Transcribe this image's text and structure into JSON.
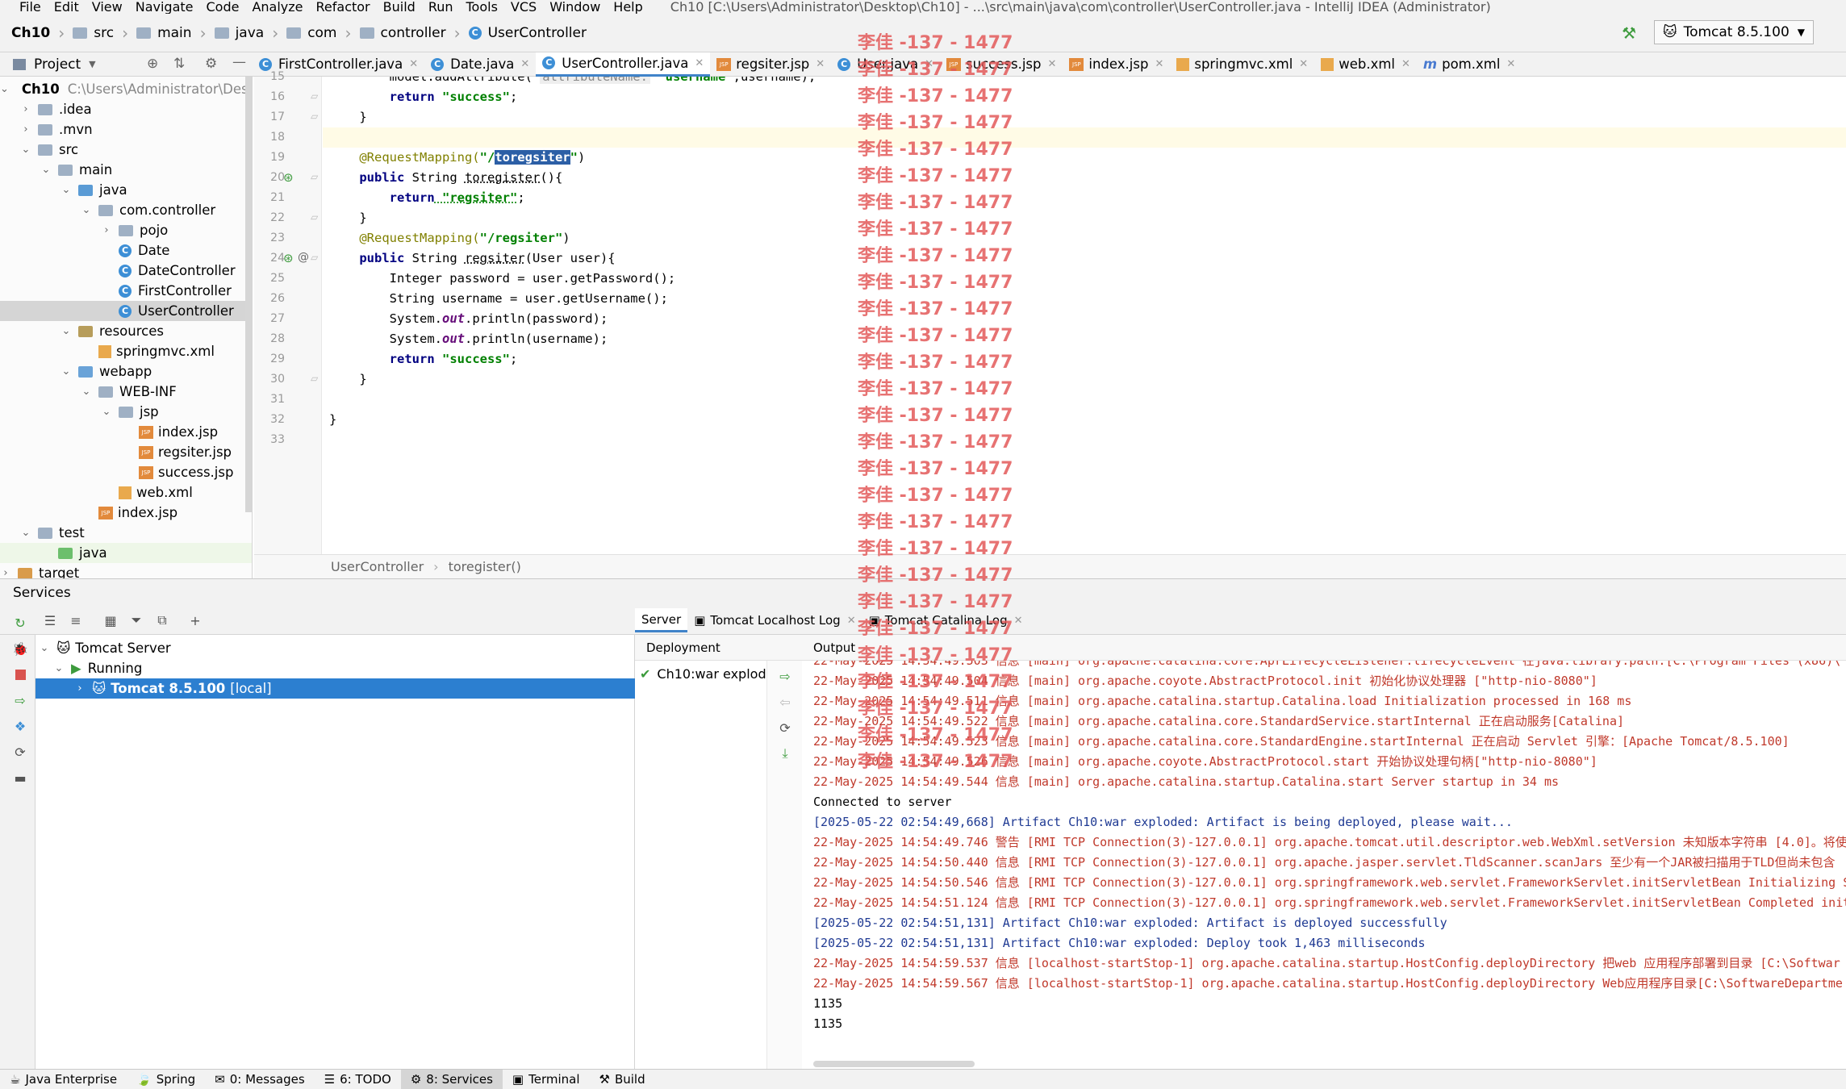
{
  "menu": {
    "items": [
      "File",
      "Edit",
      "View",
      "Navigate",
      "Code",
      "Analyze",
      "Refactor",
      "Build",
      "Run",
      "Tools",
      "VCS",
      "Window",
      "Help"
    ],
    "window_title": "Ch10 [C:\\Users\\Administrator\\Desktop\\Ch10] - ...\\src\\main\\java\\com\\controller\\UserController.java - IntelliJ IDEA (Administrator)"
  },
  "breadcrumbs": [
    "Ch10",
    "src",
    "main",
    "java",
    "com",
    "controller",
    "UserController"
  ],
  "run_config": "Tomcat 8.5.100",
  "project_panel": {
    "title": "Project",
    "root_path": "C:\\Users\\Administrator\\Deskto",
    "nodes": [
      {
        "label": "Ch10",
        "depth": 0,
        "arrow": "down",
        "icon": "folder"
      },
      {
        "label": ".idea",
        "depth": 1,
        "arrow": "right",
        "icon": "folder"
      },
      {
        "label": ".mvn",
        "depth": 1,
        "arrow": "right",
        "icon": "folder"
      },
      {
        "label": "src",
        "depth": 1,
        "arrow": "down",
        "icon": "folder"
      },
      {
        "label": "main",
        "depth": 2,
        "arrow": "down",
        "icon": "folder"
      },
      {
        "label": "java",
        "depth": 3,
        "arrow": "down",
        "icon": "folder-blue"
      },
      {
        "label": "com.controller",
        "depth": 4,
        "arrow": "down",
        "icon": "package"
      },
      {
        "label": "pojo",
        "depth": 5,
        "arrow": "right",
        "icon": "package"
      },
      {
        "label": "Date",
        "depth": 5,
        "arrow": "",
        "icon": "class"
      },
      {
        "label": "DateController",
        "depth": 5,
        "arrow": "",
        "icon": "class"
      },
      {
        "label": "FirstController",
        "depth": 5,
        "arrow": "",
        "icon": "class"
      },
      {
        "label": "UserController",
        "depth": 5,
        "arrow": "",
        "icon": "class"
      },
      {
        "label": "resources",
        "depth": 3,
        "arrow": "down",
        "icon": "folder-res"
      },
      {
        "label": "springmvc.xml",
        "depth": 4,
        "arrow": "",
        "icon": "xml"
      },
      {
        "label": "webapp",
        "depth": 3,
        "arrow": "down",
        "icon": "folder-web"
      },
      {
        "label": "WEB-INF",
        "depth": 4,
        "arrow": "down",
        "icon": "folder"
      },
      {
        "label": "jsp",
        "depth": 5,
        "arrow": "down",
        "icon": "folder"
      },
      {
        "label": "index.jsp",
        "depth": 6,
        "arrow": "",
        "icon": "jsp"
      },
      {
        "label": "regsiter.jsp",
        "depth": 6,
        "arrow": "",
        "icon": "jsp"
      },
      {
        "label": "success.jsp",
        "depth": 6,
        "arrow": "",
        "icon": "jsp"
      },
      {
        "label": "web.xml",
        "depth": 5,
        "arrow": "",
        "icon": "xml"
      },
      {
        "label": "index.jsp",
        "depth": 4,
        "arrow": "",
        "icon": "jsp"
      },
      {
        "label": "test",
        "depth": 1,
        "arrow": "down",
        "icon": "folder"
      },
      {
        "label": "java",
        "depth": 2,
        "arrow": "",
        "icon": "folder-green"
      },
      {
        "label": "target",
        "depth": 0,
        "arrow": "right",
        "icon": "folder-orange"
      }
    ]
  },
  "editor_tabs": [
    "FirstController.java",
    "Date.java",
    "UserController.java",
    "regsiter.jsp",
    "User.java",
    "success.jsp",
    "index.jsp",
    "springmvc.xml",
    "web.xml",
    "pom.xml"
  ],
  "code": {
    "line_numbers": [
      "15",
      "16",
      "17",
      "18",
      "19",
      "20",
      "21",
      "22",
      "23",
      "24",
      "25",
      "26",
      "27",
      "28",
      "29",
      "30",
      "31",
      "32",
      "33"
    ],
    "l15_a": "        model.addAttribute( ",
    "l15_hint": "attributeName:",
    "l15_str": " \"username\"",
    "l15_b": ",username);",
    "l16_kw": "        return",
    "l16_str": " \"success\"",
    "l16_b": ";",
    "l17": "    }",
    "l19_ann": "    @RequestMapping(",
    "l19_str_a": "\"/",
    "l19_sel": "toregsiter",
    "l19_str_b": "\"",
    "l19_end": ")",
    "l20_kw": "    public",
    "l20_b": " String ",
    "l20_name": "toregister",
    "l20_c": "(){",
    "l21_kw": "        return",
    "l21_str": " \"regsiter\"",
    "l21_b": ";",
    "l22": "    }",
    "l23_ann": "    @RequestMapping(",
    "l23_str": "\"/regsiter\"",
    "l23_end": ")",
    "l24_kw": "    public",
    "l24_b": " String ",
    "l24_name": "regsiter",
    "l24_c": "(User user){",
    "l25": "        Integer password = user.getPassword();",
    "l26": "        String username = user.getUsername();",
    "l27_a": "        System.",
    "l27_fld": "out",
    "l27_b": ".println(password);",
    "l28_a": "        System.",
    "l28_fld": "out",
    "l28_b": ".println(username);",
    "l29_kw": "        return",
    "l29_str": " \"success\"",
    "l29_b": ";",
    "l30": "    }",
    "l32": "}"
  },
  "editor_breadcrumb": [
    "UserController",
    "toregister()"
  ],
  "services": {
    "title": "Services",
    "tree": {
      "server": "Tomcat Server",
      "status": "Running",
      "instance": "Tomcat 8.5.100",
      "instance_suffix": "[local]"
    },
    "tabs": [
      "Server",
      "Tomcat Localhost Log",
      "Tomcat Catalina Log"
    ],
    "deployment_header": "Deployment",
    "deployment_item": "Ch10:war exploded",
    "output_header": "Output",
    "output_lines": [
      {
        "cls": "red",
        "text": "22-May-2025 14:54:49.503 信息 [main] org.apache.catalina.core.AprLifecycleListener.lifecycleEvent 在java.library.path:[C:\\Program Files (x86)\\"
      },
      {
        "cls": "red",
        "text": "22-May-2025 14:54:49.504 信息 [main] org.apache.coyote.AbstractProtocol.init 初始化协议处理器 [\"http-nio-8080\"]"
      },
      {
        "cls": "red",
        "text": "22-May-2025 14:54:49.511 信息 [main] org.apache.catalina.startup.Catalina.load Initialization processed in 168 ms"
      },
      {
        "cls": "red",
        "text": "22-May-2025 14:54:49.522 信息 [main] org.apache.catalina.core.StandardService.startInternal 正在启动服务[Catalina]"
      },
      {
        "cls": "red",
        "text": "22-May-2025 14:54:49.523 信息 [main] org.apache.catalina.core.StandardEngine.startInternal 正在启动 Servlet 引擎：[Apache Tomcat/8.5.100]"
      },
      {
        "cls": "red",
        "text": "22-May-2025 14:54:49.526 信息 [main] org.apache.coyote.AbstractProtocol.start 开始协议处理句柄[\"http-nio-8080\"]"
      },
      {
        "cls": "red",
        "text": "22-May-2025 14:54:49.544 信息 [main] org.apache.catalina.startup.Catalina.start Server startup in 34 ms"
      },
      {
        "cls": "blk",
        "text": "Connected to server"
      },
      {
        "cls": "blue",
        "text": "[2025-05-22 02:54:49,668] Artifact Ch10:war exploded: Artifact is being deployed, please wait..."
      },
      {
        "cls": "red",
        "text": "22-May-2025 14:54:49.746 警告 [RMI TCP Connection(3)-127.0.0.1] org.apache.tomcat.util.descriptor.web.WebXml.setVersion 未知版本字符串 [4.0]。将使"
      },
      {
        "cls": "red",
        "text": "22-May-2025 14:54:50.440 信息 [RMI TCP Connection(3)-127.0.0.1] org.apache.jasper.servlet.TldScanner.scanJars 至少有一个JAR被扫描用于TLD但尚未包含"
      },
      {
        "cls": "red",
        "text": "22-May-2025 14:54:50.546 信息 [RMI TCP Connection(3)-127.0.0.1] org.springframework.web.servlet.FrameworkServlet.initServletBean Initializing S"
      },
      {
        "cls": "red",
        "text": "22-May-2025 14:54:51.124 信息 [RMI TCP Connection(3)-127.0.0.1] org.springframework.web.servlet.FrameworkServlet.initServletBean Completed init"
      },
      {
        "cls": "blue",
        "text": "[2025-05-22 02:54:51,131] Artifact Ch10:war exploded: Artifact is deployed successfully"
      },
      {
        "cls": "blue",
        "text": "[2025-05-22 02:54:51,131] Artifact Ch10:war exploded: Deploy took 1,463 milliseconds"
      },
      {
        "cls": "red",
        "text": "22-May-2025 14:54:59.537 信息 [localhost-startStop-1] org.apache.catalina.startup.HostConfig.deployDirectory 把web 应用程序部署到目录 [C:\\Softwar"
      },
      {
        "cls": "red",
        "text": "22-May-2025 14:54:59.567 信息 [localhost-startStop-1] org.apache.catalina.startup.HostConfig.deployDirectory Web应用程序目录[C:\\SoftwareDepartme"
      },
      {
        "cls": "blk",
        "text": "1135"
      },
      {
        "cls": "blk",
        "text": "1135"
      }
    ]
  },
  "statusbar": [
    "Java Enterprise",
    "Spring",
    "0: Messages",
    "6: TODO",
    "8: Services",
    "Terminal",
    "Build"
  ],
  "watermark": "李佳 -137 - 1477",
  "colors": {
    "accent": "#4083c9",
    "selection": "#2c7fd0",
    "log_red": "#c0392b",
    "log_blue": "#1f3a93",
    "watermark": "#e35a5a"
  }
}
